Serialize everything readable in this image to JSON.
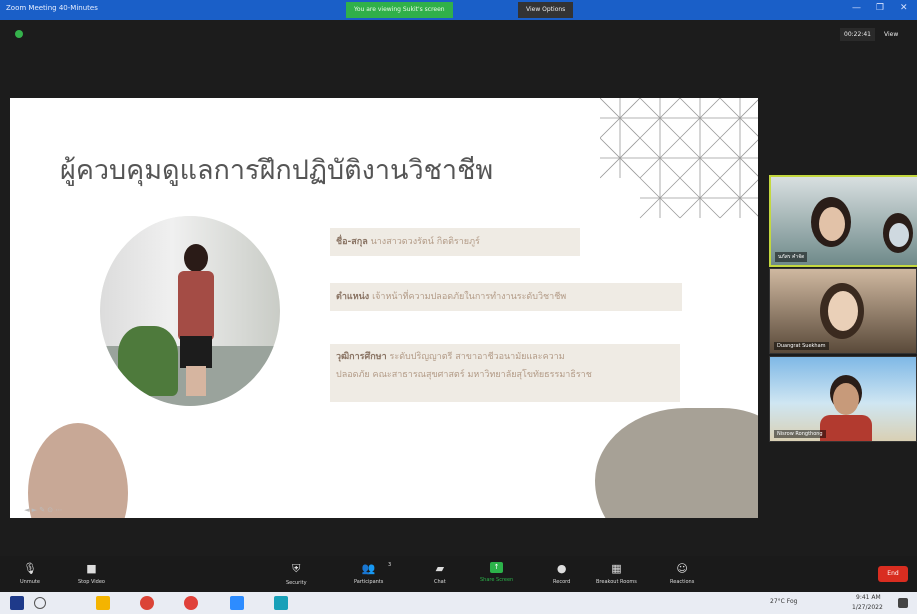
{
  "window": {
    "title": "Zoom Meeting 40-Minutes",
    "share_notice": "You are viewing Sukit's screen",
    "view_options": "View Options",
    "minimize": "—",
    "restore": "❐",
    "close": "✕"
  },
  "meeting": {
    "timer": "00:22:41",
    "view_label": "View"
  },
  "slide": {
    "heading": "ผู้ควบคุมดูแลการฝึกปฏิบัติงานวิชาชีพ",
    "name_label": "ชื่อ-สกุล",
    "name_value": "นางสาวดวงรัตน์ กิตติรายภูร์",
    "position_label": "ตำแหน่ง",
    "position_value": "เจ้าหน้าที่ความปลอดภัยในการทำงานระดับวิชาชีพ",
    "education_label": "วุฒิการศึกษา",
    "education_value_1": "ระดับปริญญาตรี สาขาอาชีวอนามัยและความ",
    "education_value_2": "ปลอดภัย คณะสาธารณสุขศาสตร์ มหาวิทยาลัยสุโขทัยธรรมาธิราช",
    "controls": "◄ ► ✎ ⊙ ⋯"
  },
  "participants": [
    {
      "name": "นภัสร คำจัด"
    },
    {
      "name": "Duangrat Suekham"
    },
    {
      "name": "Nisrow Rongthong"
    }
  ],
  "controls": {
    "unmute": "Unmute",
    "stop_video": "Stop Video",
    "security": "Security",
    "participants": "Participants",
    "participants_count": "3",
    "chat": "Chat",
    "share_screen": "Share Screen",
    "record": "Record",
    "breakout_rooms": "Breakout Rooms",
    "reactions": "Reactions",
    "end": "End"
  },
  "taskbar": {
    "weather": "27°C Fog",
    "time": "9:41 AM",
    "date": "1/27/2022"
  },
  "colors": {
    "titlebar": "#1a5fc8",
    "share_green": "#2cb34a",
    "end_red": "#d92d20",
    "active_speaker": "#c4d83e"
  }
}
